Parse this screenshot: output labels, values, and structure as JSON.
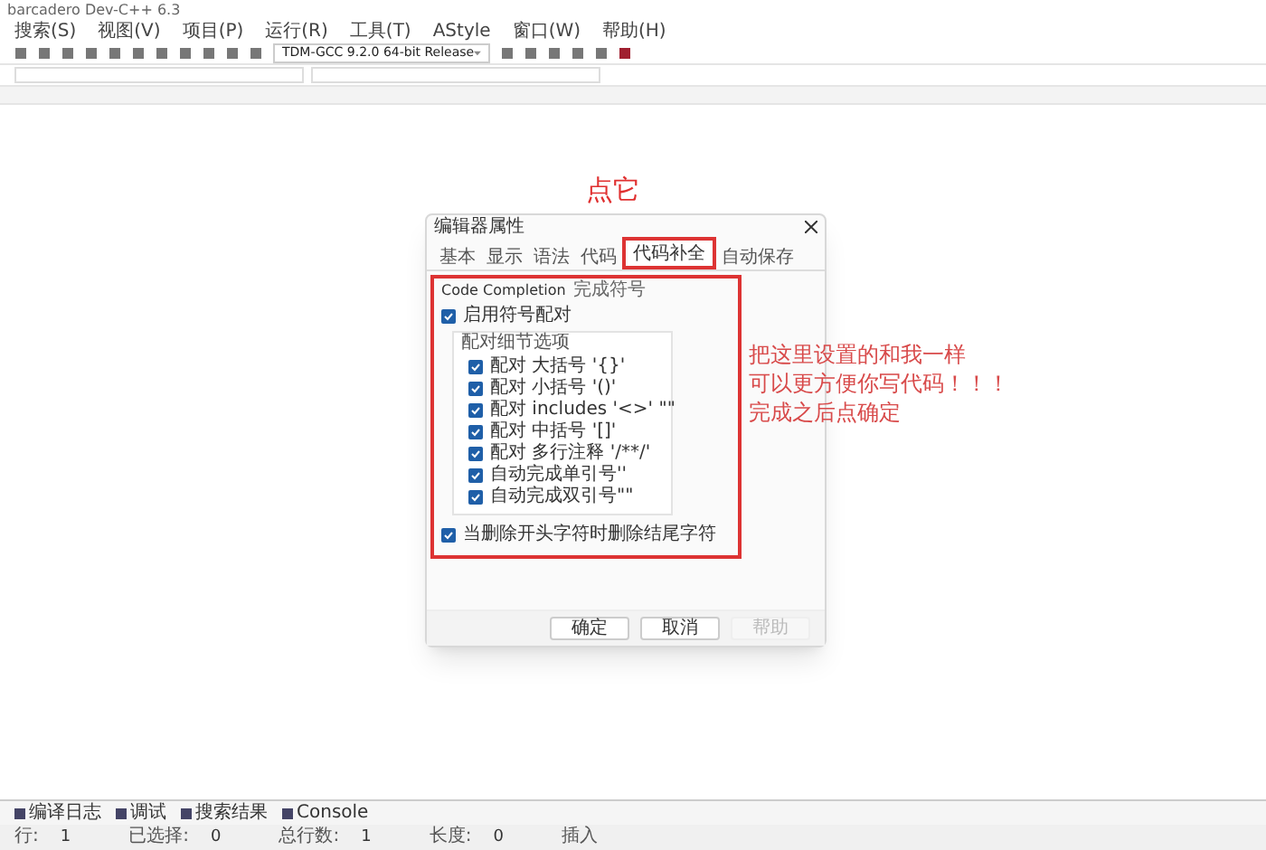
{
  "window": {
    "title": "barcadero Dev-C++ 6.3"
  },
  "menu": [
    "搜索(S)",
    "视图(V)",
    "项目(P)",
    "运行(R)",
    "工具(T)",
    "AStyle",
    "窗口(W)",
    "帮助(H)"
  ],
  "toolbar": {
    "compiler": "TDM-GCC 9.2.0 64-bit Release"
  },
  "dialog": {
    "title": "编辑器属性",
    "tabs": [
      {
        "label": "基本",
        "selected": false
      },
      {
        "label": "显示",
        "selected": false
      },
      {
        "label": "语法",
        "selected": false
      },
      {
        "label": "代码",
        "selected": false
      },
      {
        "label": "代码补全",
        "selected": true
      },
      {
        "label": "自动保存",
        "selected": false
      }
    ],
    "group_title": "Code Completion",
    "group_subtitle": "完成符号",
    "enable": {
      "label": "启用符号配对",
      "checked": true
    },
    "subgroup_title": "配对细节选项",
    "options": [
      {
        "label": "配对 大括号 '{}'",
        "checked": true
      },
      {
        "label": "配对 小括号 '()'",
        "checked": true
      },
      {
        "label": "配对 includes '<>' \"\"",
        "checked": true
      },
      {
        "label": "配对 中括号 '[]'",
        "checked": true
      },
      {
        "label": "配对 多行注释 '/**/'",
        "checked": true
      },
      {
        "label": "自动完成单引号''",
        "checked": true
      },
      {
        "label": "自动完成双引号\"\"",
        "checked": true
      }
    ],
    "delete_option": {
      "label": "当删除开头字符时删除结尾字符",
      "checked": true
    },
    "buttons": [
      {
        "label": "确定",
        "disabled": false
      },
      {
        "label": "取消",
        "disabled": false
      },
      {
        "label": "帮助",
        "disabled": true
      }
    ]
  },
  "annotations": {
    "click_label": "点它",
    "note": [
      "把这里设置的和我一样",
      "可以更方便你写代码！！！",
      "完成之后点确定"
    ]
  },
  "bottom_tabs": [
    "编译日志",
    "调试",
    "搜索结果",
    "Console"
  ],
  "status_bar": [
    {
      "label": "行:",
      "value": "1"
    },
    {
      "label": "已选择:",
      "value": "0"
    },
    {
      "label": "总行数:",
      "value": "1"
    },
    {
      "label": "长度:",
      "value": "0"
    },
    {
      "label": "插入"
    }
  ]
}
